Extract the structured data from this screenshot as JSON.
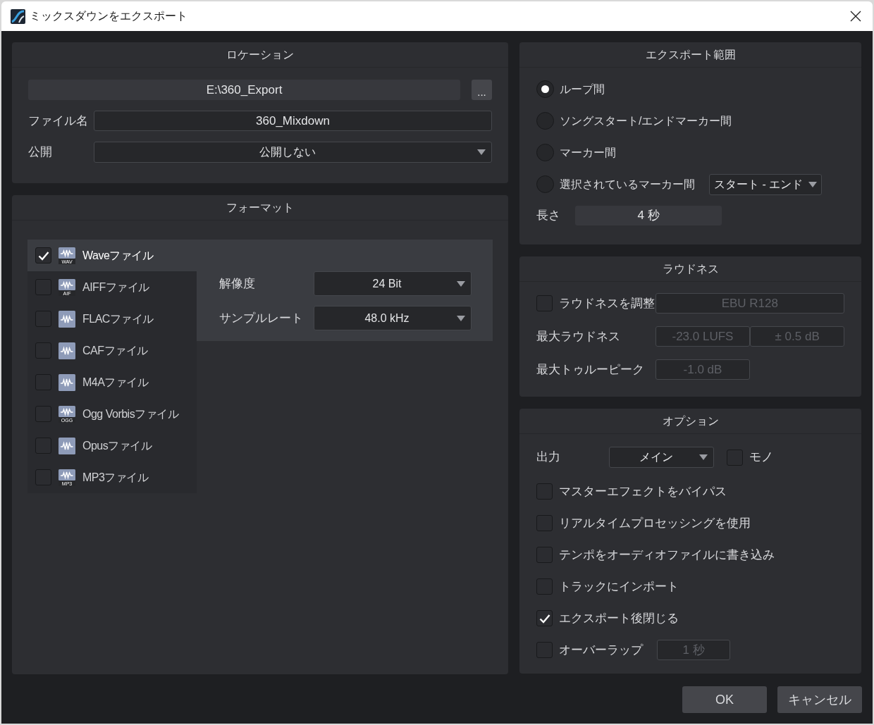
{
  "window": {
    "title": "ミックスダウンをエクスポート"
  },
  "location": {
    "title": "ロケーション",
    "path": "E:\\360_Export",
    "browse": "...",
    "filename_label": "ファイル名",
    "filename": "360_Mixdown",
    "publish_label": "公開",
    "publish": "公開しない"
  },
  "format": {
    "title": "フォーマット",
    "items": [
      {
        "label": "Waveファイル",
        "badge": "WAV",
        "checked": true,
        "selected": true
      },
      {
        "label": "AIFFファイル",
        "badge": "AIF",
        "checked": false,
        "selected": false
      },
      {
        "label": "FLACファイル",
        "checked": false,
        "selected": false
      },
      {
        "label": "CAFファイル",
        "checked": false,
        "selected": false
      },
      {
        "label": "M4Aファイル",
        "checked": false,
        "selected": false
      },
      {
        "label": "Ogg Vorbisファイル",
        "badge": "OGG",
        "checked": false,
        "selected": false
      },
      {
        "label": "Opusファイル",
        "checked": false,
        "selected": false
      },
      {
        "label": "MP3ファイル",
        "badge": "MP3",
        "checked": false,
        "selected": false
      }
    ],
    "settings": [
      {
        "label": "解像度",
        "value": "24 Bit"
      },
      {
        "label": "サンプルレート",
        "value": "48.0 kHz"
      }
    ]
  },
  "export_range": {
    "title": "エクスポート範囲",
    "options": [
      {
        "label": "ループ間",
        "selected": true
      },
      {
        "label": "ソングスタート/エンドマーカー間",
        "selected": false
      },
      {
        "label": "マーカー間",
        "selected": false
      },
      {
        "label": "選択されているマーカー間",
        "selected": false,
        "dropdown": "スタート - エンド"
      }
    ],
    "length_label": "長さ",
    "length": "4 秒"
  },
  "loudness": {
    "title": "ラウドネス",
    "adjust": {
      "label": "ラウドネスを調整",
      "checked": false
    },
    "preset": "EBU R128",
    "disabled": true,
    "max_loudness_label": "最大ラウドネス",
    "max_loudness": "-23.0 LUFS",
    "tolerance": "± 0.5 dB",
    "max_true_peak_label": "最大トゥルーピーク",
    "max_true_peak": "-1.0 dB"
  },
  "options": {
    "title": "オプション",
    "output_label": "出力",
    "output": "メイン",
    "mono": {
      "label": "モノ",
      "checked": false
    },
    "checks": [
      {
        "label": "マスターエフェクトをバイパス",
        "checked": false
      },
      {
        "label": "リアルタイムプロセッシングを使用",
        "checked": false
      },
      {
        "label": "テンポをオーディオファイルに書き込み",
        "checked": false
      },
      {
        "label": "トラックにインポート",
        "checked": false
      },
      {
        "label": "エクスポート後閉じる",
        "checked": true
      },
      {
        "label": "オーバーラップ",
        "checked": false,
        "field": "1 秒",
        "field_disabled": true
      }
    ]
  },
  "buttons": [
    "OK",
    "キャンセル"
  ]
}
